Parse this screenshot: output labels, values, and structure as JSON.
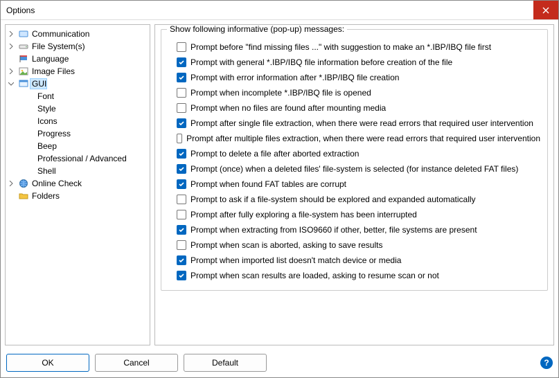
{
  "window": {
    "title": "Options"
  },
  "tree": {
    "communication": "Communication",
    "file_systems": "File System(s)",
    "language": "Language",
    "image_files": "Image Files",
    "gui": "GUI",
    "gui_children": {
      "font": "Font",
      "style": "Style",
      "icons": "Icons",
      "progress": "Progress",
      "beep": "Beep",
      "professional": "Professional / Advanced",
      "shell": "Shell"
    },
    "online_check": "Online Check",
    "folders": "Folders"
  },
  "group": {
    "title": "Show following informative (pop-up) messages:"
  },
  "options": [
    {
      "checked": false,
      "label": "Prompt before \"find missing files ...\" with suggestion to make an *.IBP/IBQ file first"
    },
    {
      "checked": true,
      "label": "Prompt with general *.IBP/IBQ file information before creation of the file"
    },
    {
      "checked": true,
      "label": "Prompt with error information after *.IBP/IBQ file creation"
    },
    {
      "checked": false,
      "label": "Prompt when incomplete *.IBP/IBQ file is opened"
    },
    {
      "checked": false,
      "label": "Prompt when no files are found after mounting media"
    },
    {
      "checked": true,
      "label": "Prompt after single file extraction, when there were read errors that required user intervention"
    },
    {
      "checked": false,
      "label": "Prompt after multiple files extraction, when there were read errors that required user intervention"
    },
    {
      "checked": true,
      "label": "Prompt to delete a file after aborted extraction"
    },
    {
      "checked": true,
      "label": "Prompt (once) when a deleted files' file-system is selected (for instance deleted FAT files)"
    },
    {
      "checked": true,
      "label": "Prompt when found FAT tables are corrupt"
    },
    {
      "checked": false,
      "label": "Prompt to ask if a file-system should be explored and expanded automatically"
    },
    {
      "checked": false,
      "label": "Prompt after fully exploring a file-system has been interrupted"
    },
    {
      "checked": true,
      "label": "Prompt when extracting from ISO9660 if other, better, file systems are present"
    },
    {
      "checked": false,
      "label": "Prompt when scan is aborted, asking to save results"
    },
    {
      "checked": true,
      "label": "Prompt when imported list doesn't match device or media"
    },
    {
      "checked": true,
      "label": "Prompt when scan results are loaded, asking to resume scan or not"
    }
  ],
  "buttons": {
    "ok": "OK",
    "cancel": "Cancel",
    "default": "Default"
  }
}
